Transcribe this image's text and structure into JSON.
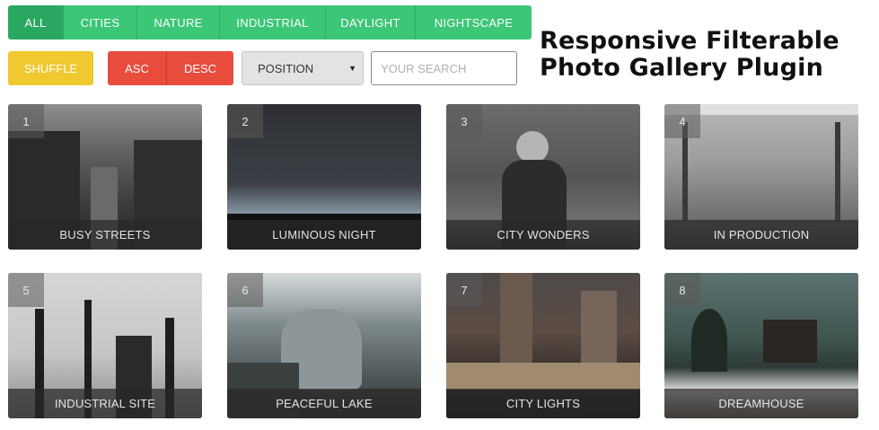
{
  "filters": {
    "items": [
      {
        "label": "ALL",
        "active": true
      },
      {
        "label": "CITIES",
        "active": false
      },
      {
        "label": "NATURE",
        "active": false
      },
      {
        "label": "INDUSTRIAL",
        "active": false
      },
      {
        "label": "DAYLIGHT",
        "active": false
      },
      {
        "label": "NIGHTSCAPE",
        "active": false
      }
    ]
  },
  "controls": {
    "shuffle_label": "SHUFFLE",
    "asc_label": "ASC",
    "desc_label": "DESC",
    "sort_select_value": "POSITION",
    "search_placeholder": "YOUR SEARCH"
  },
  "title": {
    "line1": "Responsive Filterable",
    "line2": "Photo Gallery Plugin"
  },
  "gallery": {
    "items": [
      {
        "number": "1",
        "caption": "BUSY STREETS"
      },
      {
        "number": "2",
        "caption": "LUMINOUS NIGHT"
      },
      {
        "number": "3",
        "caption": "CITY WONDERS"
      },
      {
        "number": "4",
        "caption": "IN PRODUCTION"
      },
      {
        "number": "5",
        "caption": "INDUSTRIAL SITE"
      },
      {
        "number": "6",
        "caption": "PEACEFUL LAKE"
      },
      {
        "number": "7",
        "caption": "CITY LIGHTS"
      },
      {
        "number": "8",
        "caption": "DREAMHOUSE"
      }
    ]
  },
  "colors": {
    "filter_green": "#3cc677",
    "filter_active": "#2aa760",
    "shuffle_yellow": "#f0c830",
    "sort_red": "#e84c3d"
  }
}
